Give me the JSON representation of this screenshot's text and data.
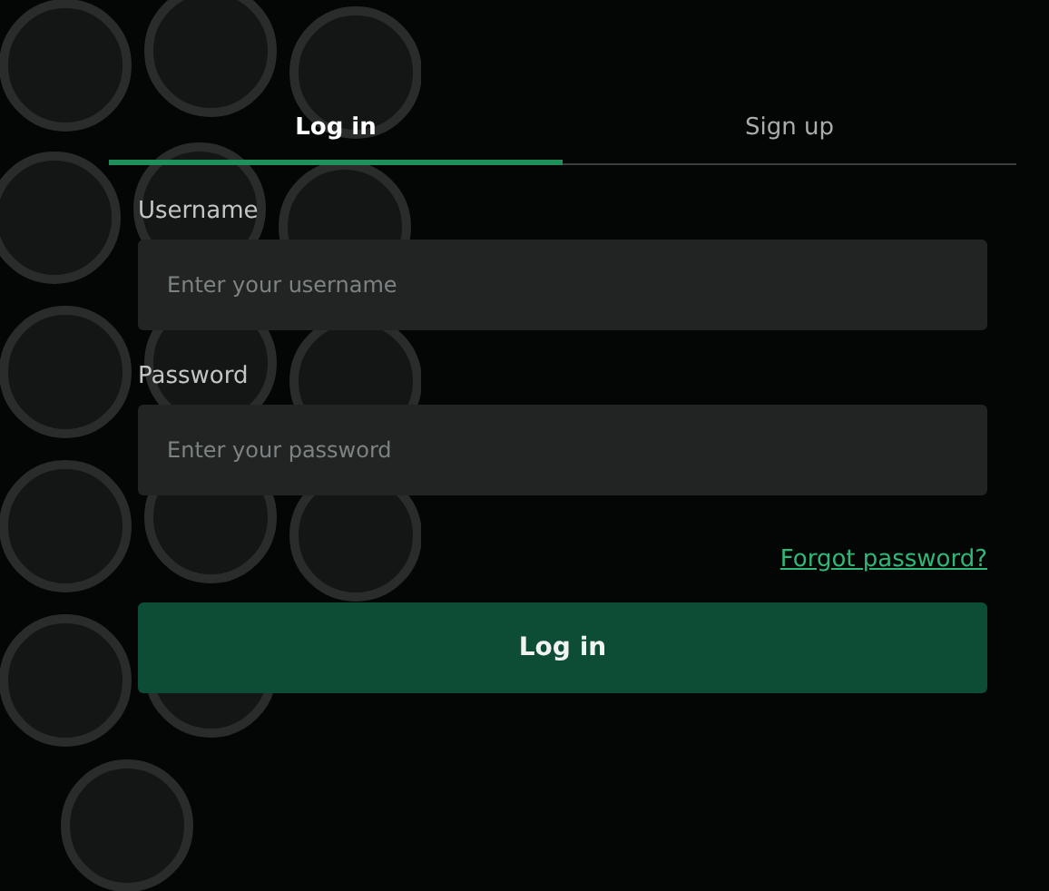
{
  "tabs": [
    {
      "label": "Log in",
      "selected": true
    },
    {
      "label": "Sign up",
      "selected": false
    }
  ],
  "form": {
    "fields": [
      {
        "label": "Username",
        "placeholder": "Enter your username"
      },
      {
        "label": "Password",
        "placeholder": "Enter your password"
      }
    ],
    "forgot_link": "Forgot password?",
    "submit": "Log in"
  }
}
